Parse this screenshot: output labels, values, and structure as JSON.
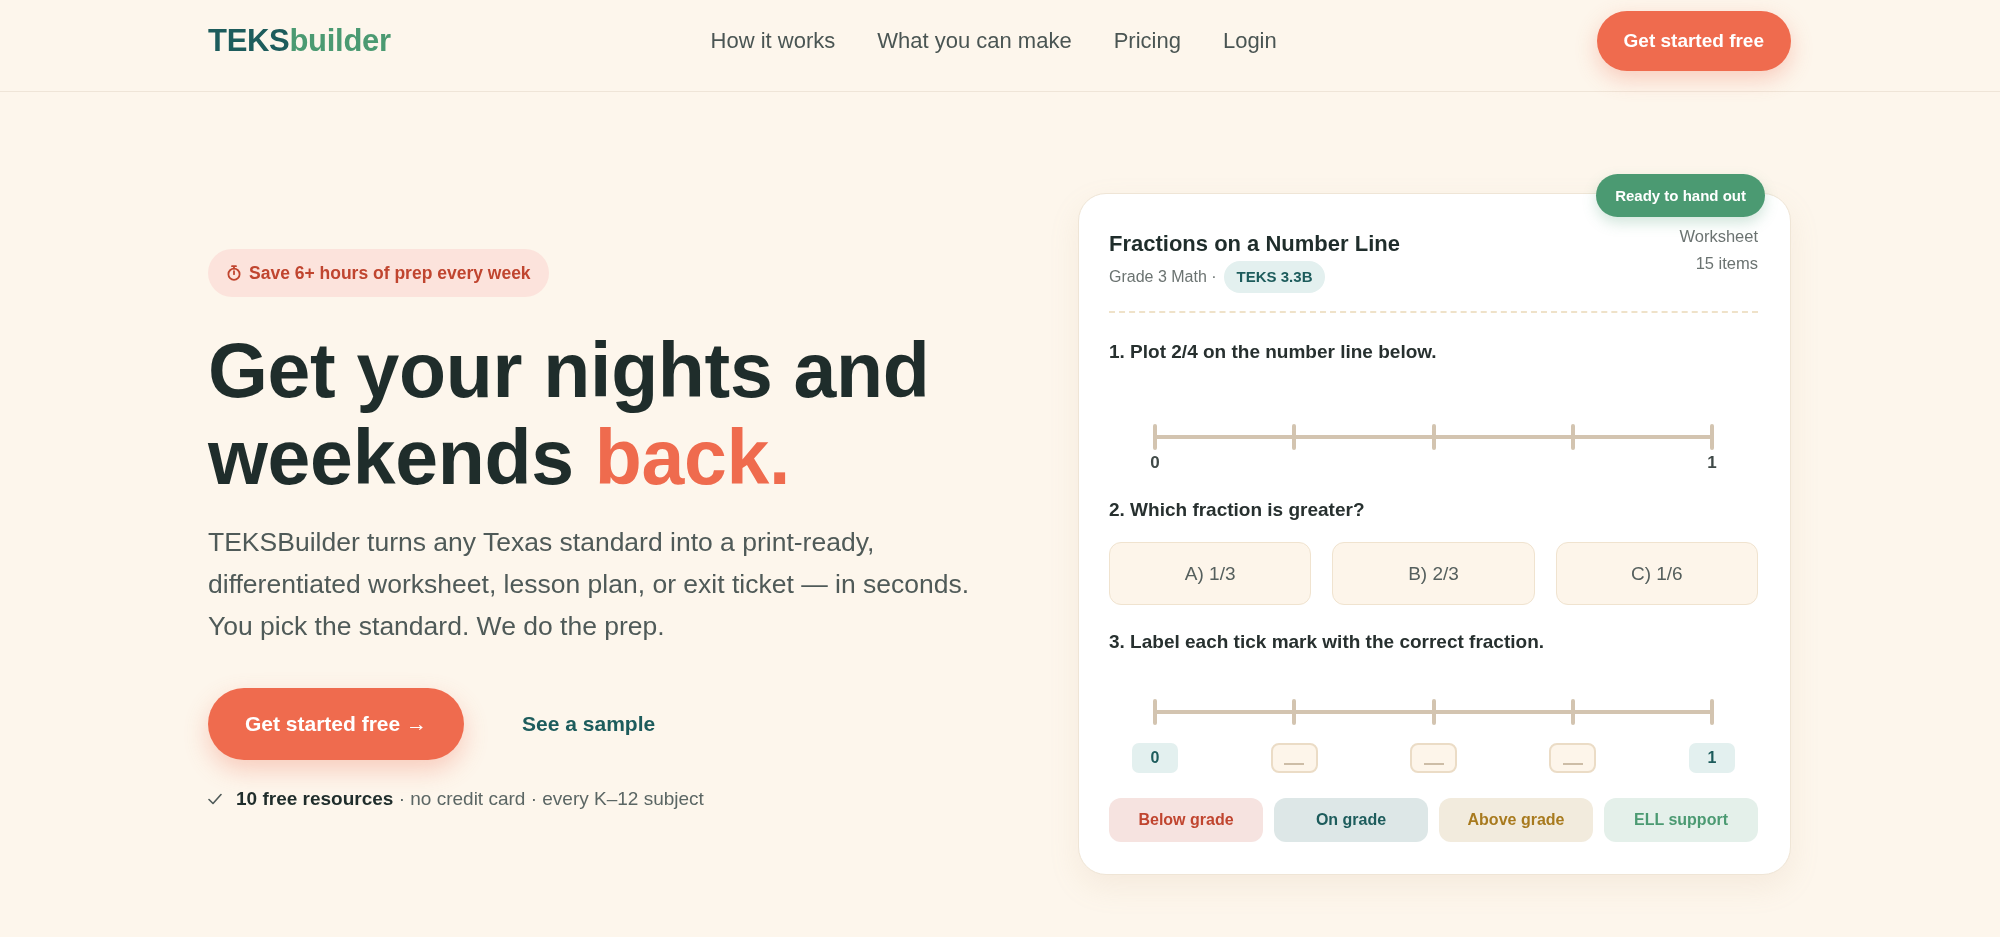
{
  "header": {
    "logo": {
      "lead": "TEKS",
      "trail": "builder"
    },
    "nav": [
      "How it works",
      "What you can make",
      "Pricing",
      "Login"
    ],
    "cta": "Get started free"
  },
  "hero": {
    "promo": "Save 6+ hours of prep every week",
    "heading": {
      "text": "Get your nights and weekends",
      "accent": "back."
    },
    "description": "TEKSBuilder turns any Texas standard into a print-ready, differentiated worksheet, lesson plan, or exit ticket — in seconds. You pick the standard. We do the prep.",
    "primary_button": "Get started free →",
    "secondary_link": "See a sample",
    "perks": "**10 free resources** · no credit card · every K–12 subject"
  },
  "worksheet": {
    "status": "Ready to hand out",
    "title": "Fractions on a Number Line",
    "course": "Grade 3 Math ·",
    "standard": "TEKS 3.3B",
    "type": "Worksheet",
    "count": "15 items",
    "questions": [
      {
        "kind": "plot",
        "prompt": "1. Plot 2/4 on the number line below.",
        "ticks": [
          {
            "kind": "labeled",
            "label": "0"
          },
          {
            "kind": "plain"
          },
          {
            "kind": "plain"
          },
          {
            "kind": "plain"
          },
          {
            "kind": "labeled",
            "label": "1"
          }
        ]
      },
      {
        "kind": "choice",
        "prompt": "2. Which fraction is greater?",
        "options": [
          "A) 1/3",
          "B) 2/3",
          "C) 1/6"
        ]
      },
      {
        "kind": "label",
        "prompt": "3. Label each tick mark with the correct fraction.",
        "ticks": [
          {
            "kind": "given",
            "label": "0"
          },
          {
            "kind": "blank"
          },
          {
            "kind": "blank"
          },
          {
            "kind": "blank"
          },
          {
            "kind": "given",
            "label": "1"
          }
        ]
      }
    ],
    "versions": [
      {
        "label": "Below grade",
        "color": "#c0452f"
      },
      {
        "label": "On grade",
        "color": "#1d5c5c"
      },
      {
        "label": "Above grade",
        "color": "#a87a1e"
      },
      {
        "label": "ELL support",
        "color": "#4b9a72"
      }
    ]
  }
}
